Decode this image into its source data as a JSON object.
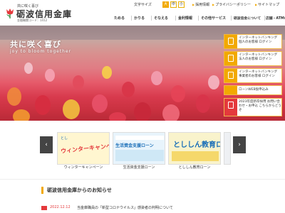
{
  "header": {
    "logo_tagline": "共に咲く喜び",
    "logo_name": "砺波信用金庫",
    "logo_code": "金融機関コード：1412",
    "font_size_label": "文字サイズ",
    "font_sizes": [
      "大",
      "中",
      "小"
    ],
    "links": [
      "採用情報",
      "プライバシーポリシー",
      "サイトマップ"
    ]
  },
  "nav": [
    "ためる",
    "かりる",
    "そなえる",
    "金利情報",
    "その他サービス",
    "砺波信金について",
    "店舗・ATMのご案内"
  ],
  "hero": {
    "title": "共に咲く喜び",
    "subtitle": "joy to bloom together"
  },
  "side_menu": [
    {
      "label": "インターネットバンキング 個人のお客様 ログイン"
    },
    {
      "label": "インターネットバンキング 法人のお客様 ログイン"
    },
    {
      "label": "インターネットバンキング 事業者のお客様 ログイン"
    },
    {
      "label": "ローンWEB仮申込み"
    },
    {
      "label": "2023年度新卒採用 お問い合わせ・お申込 こちらからどうぞ"
    }
  ],
  "banners": [
    {
      "caption": "ウィンターキャンペーン",
      "top": "とし",
      "big": "ウィンターキャンペーン"
    },
    {
      "caption": "生活資金支援ローン",
      "main": "生活資金支援ローン"
    },
    {
      "caption": "とししん教育ローン",
      "main": "とししん教育ローン"
    }
  ],
  "news": {
    "title": "砺波信用金庫からのお知らせ",
    "items": [
      {
        "date": "2022.12.12",
        "text": "当金庫職員の「新型コロナウイルス」感染者の判明について"
      }
    ]
  },
  "colors": {
    "accent": "#f2a900",
    "red": "#e4393c",
    "blue": "#1b6fb8"
  }
}
